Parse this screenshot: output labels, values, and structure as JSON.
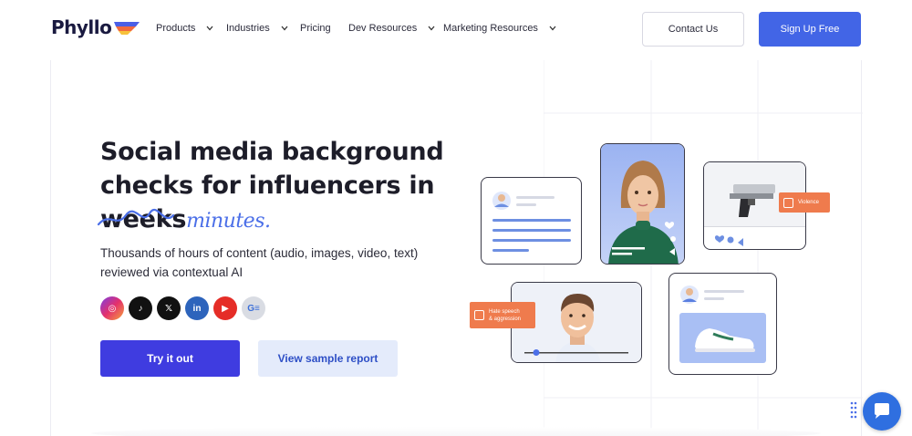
{
  "brand": {
    "name": "Phyllo"
  },
  "nav": {
    "items": [
      {
        "label": "Products",
        "has_dropdown": true
      },
      {
        "label": "Industries",
        "has_dropdown": true
      },
      {
        "label": "Pricing",
        "has_dropdown": false
      },
      {
        "label": "Dev Resources",
        "has_dropdown": true
      },
      {
        "label": "Marketing Resources",
        "has_dropdown": true
      }
    ],
    "contact_label": "Contact Us",
    "signup_label": "Sign Up Free"
  },
  "hero": {
    "headline_line1": "Social media background",
    "headline_line2": "checks for influencers in",
    "struck_word": "weeks",
    "replacement_word": "minutes.",
    "subtext": "Thousands of hours of content (audio, images, video, text) reviewed via contextual AI",
    "socials": [
      {
        "name": "instagram-icon",
        "glyph": "◎",
        "color": "#d6307b"
      },
      {
        "name": "tiktok-icon",
        "glyph": "♪",
        "color": "#111111"
      },
      {
        "name": "x-icon",
        "glyph": "𝕏",
        "color": "#111111"
      },
      {
        "name": "linkedin-icon",
        "glyph": "in",
        "color": "#2d64bc"
      },
      {
        "name": "youtube-icon",
        "glyph": "▶",
        "color": "#e52d27"
      },
      {
        "name": "google-news-icon",
        "glyph": "G≡",
        "color": "#d9dce3"
      }
    ],
    "try_label": "Try it out",
    "sample_label": "View sample report"
  },
  "illustration": {
    "violence_tag": "Violence",
    "hate_tag_line1": "Hate speech",
    "hate_tag_line2": "& aggression"
  },
  "colors": {
    "primary": "#3f3ce0",
    "signup": "#4265e6",
    "accent_script": "#4b6fe8",
    "tag_orange": "#ef7b4d",
    "chat": "#2f6fe0"
  }
}
